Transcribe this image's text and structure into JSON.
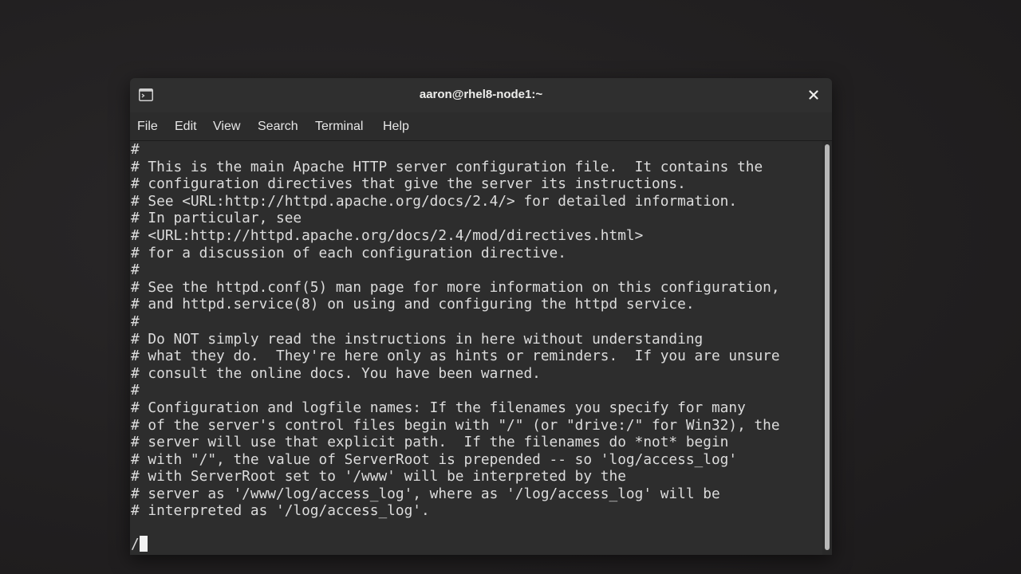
{
  "window": {
    "title": "aaron@rhel8-node1:~",
    "icons": {
      "app": "terminal-icon",
      "close": "close-icon"
    }
  },
  "menu": {
    "items": [
      "File",
      "Edit",
      "View",
      "Search",
      "Terminal",
      "Help"
    ]
  },
  "terminal": {
    "lines": [
      "#",
      "# This is the main Apache HTTP server configuration file.  It contains the",
      "# configuration directives that give the server its instructions.",
      "# See <URL:http://httpd.apache.org/docs/2.4/> for detailed information.",
      "# In particular, see",
      "# <URL:http://httpd.apache.org/docs/2.4/mod/directives.html>",
      "# for a discussion of each configuration directive.",
      "#",
      "# See the httpd.conf(5) man page for more information on this configuration,",
      "# and httpd.service(8) on using and configuring the httpd service.",
      "#",
      "# Do NOT simply read the instructions in here without understanding",
      "# what they do.  They're here only as hints or reminders.  If you are unsure",
      "# consult the online docs. You have been warned.",
      "#",
      "# Configuration and logfile names: If the filenames you specify for many",
      "# of the server's control files begin with \"/\" (or \"drive:/\" for Win32), the",
      "# server will use that explicit path.  If the filenames do *not* begin",
      "# with \"/\", the value of ServerRoot is prepended -- so 'log/access_log'",
      "# with ServerRoot set to '/www' will be interpreted by the",
      "# server as '/www/log/access_log', where as '/log/access_log' will be",
      "# interpreted as '/log/access_log'."
    ],
    "command_line": "/"
  },
  "colors": {
    "background": "#2d2d2d",
    "text": "#dcdcdc",
    "titlebar": "#2f2f2f"
  }
}
